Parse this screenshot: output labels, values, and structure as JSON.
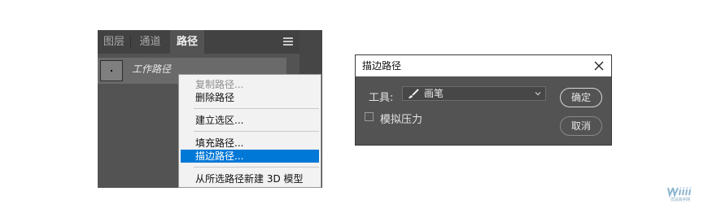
{
  "panel": {
    "tabs": [
      {
        "label": "图层",
        "active": false
      },
      {
        "label": "通道",
        "active": false
      },
      {
        "label": "路径",
        "active": true
      }
    ],
    "menu_icon": "hamburger-menu-icon",
    "path_item": {
      "name": "工作路径"
    }
  },
  "context_menu": {
    "items": [
      {
        "label": "复制路径...",
        "state": "disabled"
      },
      {
        "label": "删除路径",
        "state": "normal"
      },
      {
        "label": "建立选区...",
        "state": "normal"
      },
      {
        "label": "填充路径...",
        "state": "normal"
      },
      {
        "label": "描边路径...",
        "state": "highlighted"
      },
      {
        "label": "从所选路径新建 3D 模型",
        "state": "normal"
      }
    ],
    "highlight_color": "#0078d7"
  },
  "dialog": {
    "title": "描边路径",
    "close_icon": "close-icon",
    "tool_label": "工具:",
    "tool_value": "画笔",
    "tool_icon": "brush-icon",
    "simulate_pressure_label": "模拟压力",
    "simulate_pressure_checked": false,
    "ok_label": "确定",
    "cancel_label": "取消"
  },
  "watermark": {
    "logo": "uiiii-logo",
    "text": "优设高手网"
  },
  "colors": {
    "panel_bg": "#535353",
    "tab_bar_bg": "#424242",
    "dialog_bg": "#535353"
  }
}
